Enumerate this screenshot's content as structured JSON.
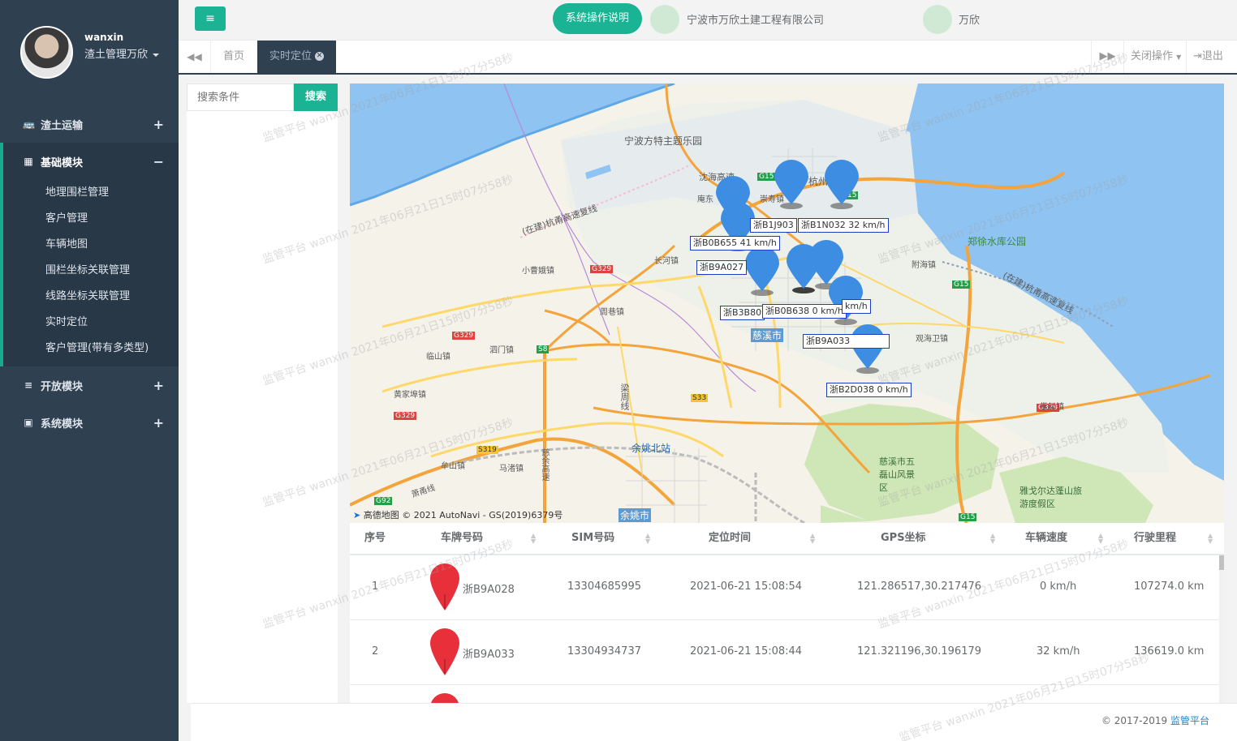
{
  "user": {
    "name": "wanxin",
    "role": "渣土管理万欣"
  },
  "sidebar": {
    "items": [
      {
        "label": "渣土运输",
        "toggle": "+"
      },
      {
        "label": "基础模块",
        "toggle": "−"
      },
      {
        "label": "开放模块",
        "toggle": "+"
      },
      {
        "label": "系统模块",
        "toggle": "+"
      }
    ],
    "sub_items": [
      "地理围栏管理",
      "客户管理",
      "车辆地图",
      "围栏坐标关联管理",
      "线路坐标关联管理",
      "实时定位",
      "客户管理(带有多类型)"
    ]
  },
  "topbar": {
    "menu_icon": "≡",
    "help_label": "系统操作说明",
    "company": "宁波市万欣土建工程有限公司",
    "user_name": "万欣"
  },
  "tabs": {
    "back_icon": "◀◀",
    "forward_icon": "▶▶",
    "items": [
      "首页",
      "实时定位"
    ],
    "close_ops": "关闭操作",
    "logout": "退出"
  },
  "search": {
    "placeholder": "搜索条件",
    "button": "搜索"
  },
  "map": {
    "place_labels": [
      "宁波方特主题乐园",
      "沈海高速",
      "庵东",
      "崇寿镇",
      "杭州湾",
      "(在建)杭甬高速复线",
      "长河镇",
      "小曹娥镇",
      "周巷镇",
      "临山镇",
      "泗门镇",
      "黄家埠镇",
      "马渚镇",
      "牟山镇",
      "梁周线",
      "余姚北站",
      "余姚市",
      "慈溪市",
      "附海镇",
      "观海卫镇",
      "郑徐水库公园",
      "(在建)杭甬高速复线",
      "掌起镇",
      "慈溪市五磊山风景区",
      "雅戈尔达蓬山旅游度假区",
      "萧甬线",
      "慈余高速"
    ],
    "road_shields": [
      "G15",
      "G15",
      "G15",
      "G15",
      "G329",
      "G329",
      "G329",
      "G329",
      "S8",
      "S33",
      "S319",
      "G92"
    ],
    "vehicle_labels": [
      "浙B1J903",
      "浙B1N032 32 km/h",
      "浙B0B655 41 km/h",
      "浙B9A027",
      "浙B3B80",
      "浙B0B638 0 km/h",
      "km/h",
      "浙B9A033",
      "浙B2D038 0 km/h"
    ],
    "copyright": "高德地图 © 2021 AutoNavi - GS(2019)6379号"
  },
  "table": {
    "headers": [
      "序号",
      "车牌号码",
      "SIM号码",
      "定位时间",
      "GPS坐标",
      "车辆速度",
      "行驶里程"
    ],
    "rows": [
      {
        "no": "1",
        "plate": "浙B9A028",
        "sim": "13304685995",
        "time": "2021-06-21 15:08:54",
        "gps": "121.286517,30.217476",
        "speed": "0 km/h",
        "mileage": "107274.0 km"
      },
      {
        "no": "2",
        "plate": "浙B9A033",
        "sim": "13304934737",
        "time": "2021-06-21 15:08:44",
        "gps": "121.321196,30.196179",
        "speed": "32 km/h",
        "mileage": "136619.0 km"
      }
    ]
  },
  "footer": {
    "copy": "© 2017-2019 ",
    "link": "监管平台"
  },
  "watermark": "监管平台 wanxin 2021年06月21日15时07分58秒",
  "colors": {
    "accent": "#1ab394",
    "sidebar": "#2f4050",
    "marker": "#3d8de3",
    "pin": "#e8303a"
  }
}
